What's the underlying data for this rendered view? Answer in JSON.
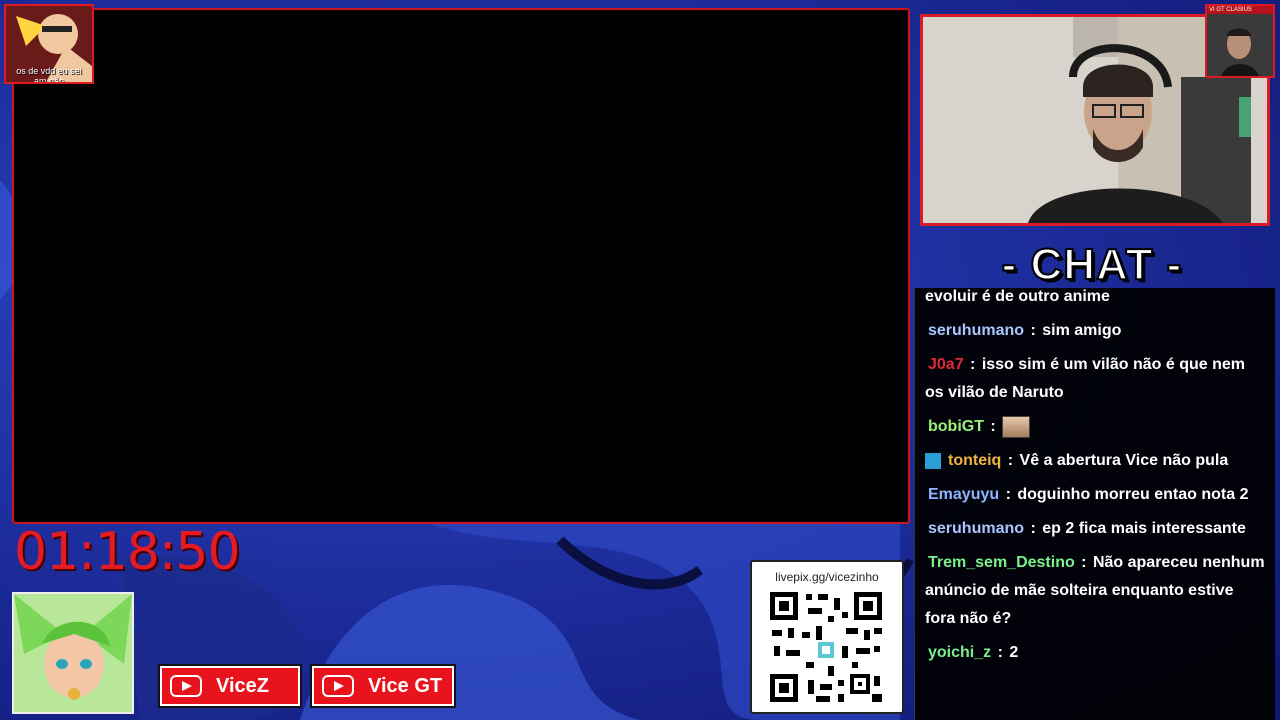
{
  "logo": {
    "caption_line1": "os de vdd eu sei",
    "caption_line2": "am não"
  },
  "mini_cam": {
    "label": "VI  GT  CLASIUS"
  },
  "chat": {
    "title": "- CHAT -",
    "messages": [
      {
        "user": "",
        "user_color": "#ffffff",
        "text": "evoluir é de outro anime"
      },
      {
        "user": "seruhumano",
        "user_color": "#a9c6ff",
        "text": "sim amigo"
      },
      {
        "user": "J0a7",
        "user_color": "#e0283a",
        "text": "isso sim é um vilão não é que nem os vilão de Naruto"
      },
      {
        "user": "bobiGT",
        "user_color": "#9cf07a",
        "text": "",
        "emote": "emote-icon"
      },
      {
        "user": "tonteiq",
        "user_color": "#f1b43c",
        "text": "Vê a abertura Vice não pula",
        "badge": "prime-badge-icon"
      },
      {
        "user": "Emayuyu",
        "user_color": "#8fb4ff",
        "text": "doguinho morreu entao nota 2"
      },
      {
        "user": "seruhumano",
        "user_color": "#a9c6ff",
        "text": "ep 2 fica mais interessante"
      },
      {
        "user": "Trem_sem_Destino",
        "user_color": "#7cf08a",
        "text": "Não apareceu nenhum anúncio de mãe solteira enquanto estive fora não é?"
      },
      {
        "user": "yoichi_z",
        "user_color": "#7cf08a",
        "text": "2"
      }
    ]
  },
  "timer": "01:18:50",
  "socials": [
    {
      "label": "ViceZ",
      "icon": "youtube-icon"
    },
    {
      "label": "Vice GT",
      "icon": "youtube-icon"
    }
  ],
  "qr": {
    "label": "livepix.gg/vicezinho"
  },
  "colors": {
    "accent_red": "#e51b24",
    "background_blue": "#1e2fa0"
  }
}
